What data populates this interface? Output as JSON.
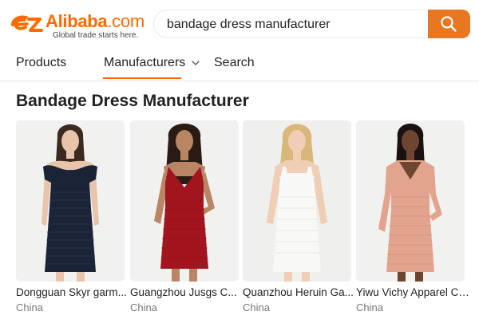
{
  "logo": {
    "name": "Alibaba",
    "suffix": ".com",
    "tagline": "Global trade starts here."
  },
  "search": {
    "query": "bandage dress manufacturer",
    "icon": "search-icon"
  },
  "tabs": [
    {
      "label": "Products",
      "active": false
    },
    {
      "label": "Manufacturers",
      "active": true
    },
    {
      "label": "Search",
      "active": false
    }
  ],
  "section": {
    "title": "Bandage Dress Manufacturer"
  },
  "suppliers": [
    {
      "name": "Dongguan Skyr garm...",
      "country": "China",
      "dress_color": "#1b2436"
    },
    {
      "name": "Guangzhou Jusgs C...",
      "country": "China",
      "dress_color": "#a3151e"
    },
    {
      "name": "Quanzhou Heruin Ga...",
      "country": "China",
      "dress_color": "#f7f7f4"
    },
    {
      "name": "Yiwu Vichy Apparel Co...",
      "country": "China",
      "dress_color": "#e3a48e"
    }
  ],
  "colors": {
    "accent": "#ff6a00",
    "search_button": "#e97722"
  }
}
